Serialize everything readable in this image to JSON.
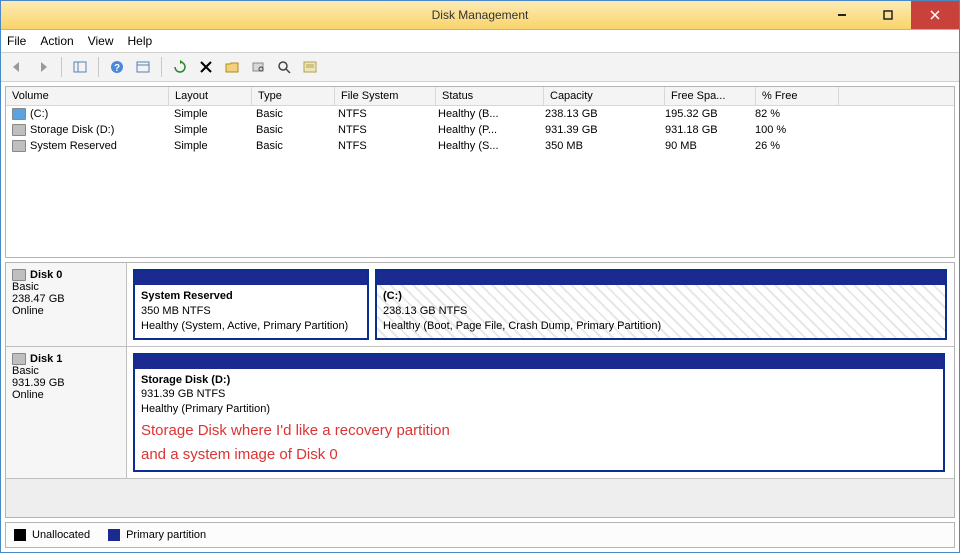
{
  "window": {
    "title": "Disk Management"
  },
  "menu": {
    "file": "File",
    "action": "Action",
    "view": "View",
    "help": "Help"
  },
  "columns": {
    "c0": "Volume",
    "c1": "Layout",
    "c2": "Type",
    "c3": "File System",
    "c4": "Status",
    "c5": "Capacity",
    "c6": "Free Spa...",
    "c7": "% Free"
  },
  "volumes": [
    {
      "name": "(C:)",
      "layout": "Simple",
      "type": "Basic",
      "fs": "NTFS",
      "status": "Healthy (B...",
      "capacity": "238.13 GB",
      "free": "195.32 GB",
      "pct": "82 %",
      "iconBlue": true
    },
    {
      "name": "Storage Disk (D:)",
      "layout": "Simple",
      "type": "Basic",
      "fs": "NTFS",
      "status": "Healthy (P...",
      "capacity": "931.39 GB",
      "free": "931.18 GB",
      "pct": "100 %",
      "iconBlue": false
    },
    {
      "name": "System Reserved",
      "layout": "Simple",
      "type": "Basic",
      "fs": "NTFS",
      "status": "Healthy (S...",
      "capacity": "350 MB",
      "free": "90 MB",
      "pct": "26 %",
      "iconBlue": false
    }
  ],
  "disks": [
    {
      "name": "Disk 0",
      "type": "Basic",
      "size": "238.47 GB",
      "state": "Online",
      "partitions": [
        {
          "title": "System Reserved",
          "sub": "350 MB NTFS",
          "status": "Healthy (System, Active, Primary Partition)",
          "widthPx": 232,
          "hatched": false
        },
        {
          "title": "(C:)",
          "sub": "238.13 GB NTFS",
          "status": "Healthy (Boot, Page File, Crash Dump, Primary Partition)",
          "widthPx": 568,
          "hatched": true
        }
      ]
    },
    {
      "name": "Disk 1",
      "type": "Basic",
      "size": "931.39 GB",
      "state": "Online",
      "partitions": [
        {
          "title": "Storage Disk  (D:)",
          "sub": "931.39 GB NTFS",
          "status": "Healthy (Primary Partition)",
          "widthPx": 808,
          "hatched": false,
          "annotation": "Storage Disk where I'd like a recovery partition",
          "annotation2": "and a system image of Disk 0"
        }
      ]
    }
  ],
  "legend": {
    "unalloc": "Unallocated",
    "primary": "Primary partition"
  }
}
